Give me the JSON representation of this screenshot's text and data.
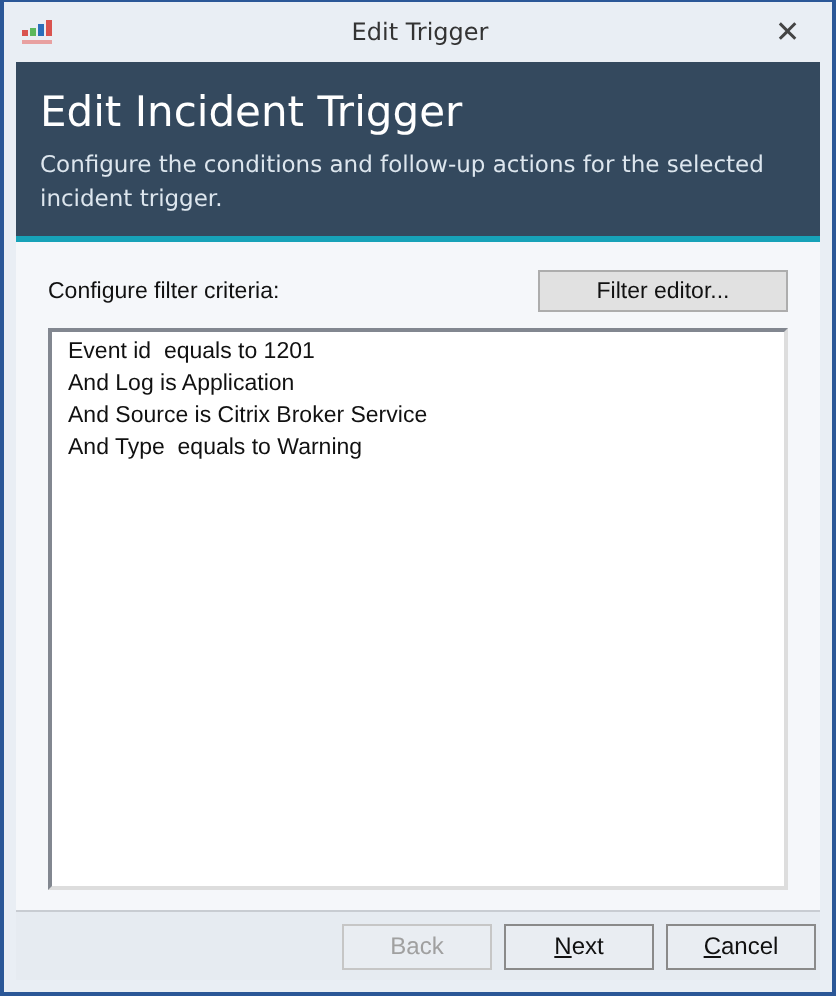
{
  "window": {
    "title": "Edit Trigger",
    "close": "✕"
  },
  "header": {
    "title": "Edit Incident Trigger",
    "subtitle": "Configure the conditions and follow-up actions for the selected incident trigger."
  },
  "filter": {
    "label": "Configure filter criteria:",
    "button": "Filter editor...",
    "lines": [
      "Event id  equals to 1201",
      "And Log is Application",
      "And Source is Citrix Broker Service",
      "And Type  equals to Warning"
    ]
  },
  "buttons": [
    {
      "label": "Back",
      "disabled": true,
      "mnemonic": false
    },
    {
      "label": "Next",
      "disabled": false,
      "mnemonic": true
    },
    {
      "label": "Cancel",
      "disabled": false,
      "mnemonic": true
    }
  ]
}
